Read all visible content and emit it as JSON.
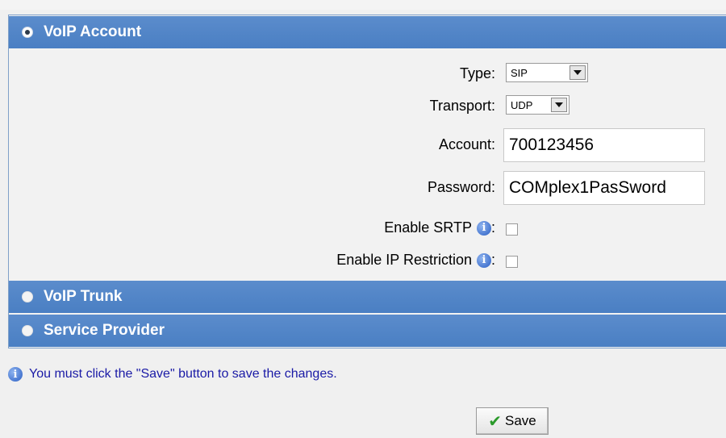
{
  "sections": {
    "voip_account": "VoIP Account",
    "voip_trunk": "VoIP Trunk",
    "service_provider": "Service Provider"
  },
  "form": {
    "type_label": "Type:",
    "type_value": "SIP",
    "transport_label": "Transport:",
    "transport_value": "UDP",
    "account_label": "Account:",
    "account_value": "700123456",
    "password_label": "Password:",
    "password_value": "COMplex1PasSword",
    "srtp_label": "Enable SRTP",
    "ip_restriction_label": "Enable IP Restriction",
    "colon": ":"
  },
  "note": "You must click the \"Save\" button to save the changes.",
  "save_label": "Save",
  "icons": {
    "radio_selected": "radio-selected-icon",
    "radio_unselected": "radio-unselected-icon",
    "info": "info-icon",
    "check": "checkmark-icon"
  },
  "colors": {
    "header_blue": "#4a7fc3",
    "note_text": "#1a1aa6",
    "check_green": "#2a9a2a"
  }
}
